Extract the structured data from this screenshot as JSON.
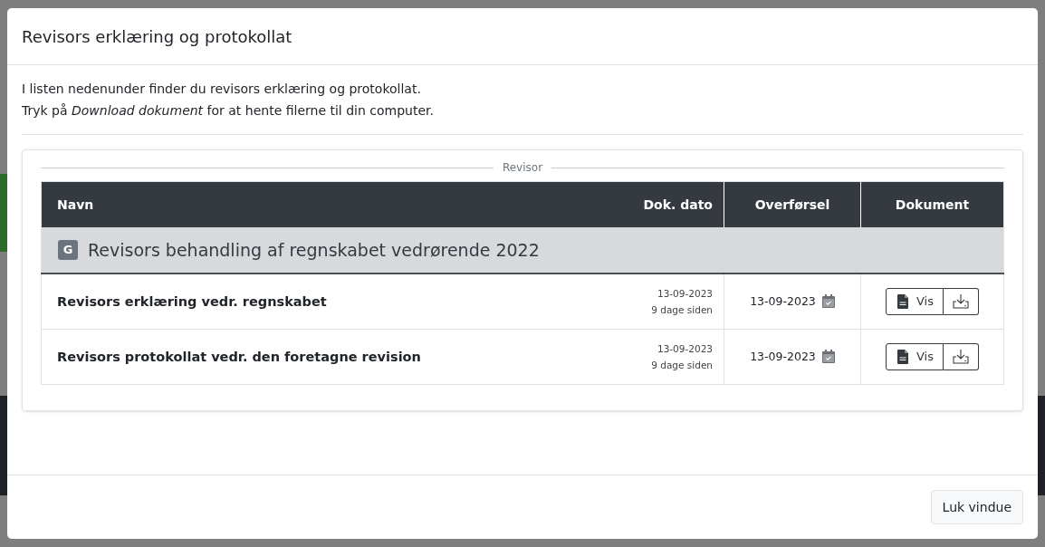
{
  "modal": {
    "title": "Revisors erklæring og protokollat"
  },
  "intro": [
    "I listen nedenunder finder du revisors erklæring og protokollat.",
    "Tryk på *Download dokument* for at hente filerne til din computer."
  ],
  "section": {
    "legend": "Revisor"
  },
  "table": {
    "columns": [
      "Navn",
      "Dok. dato",
      "Overførsel",
      "Dokument"
    ],
    "group": {
      "badge": "G",
      "title": "Revisors behandling af regnskabet vedrørende 2022"
    },
    "rows": [
      {
        "name": "Revisors erklæring vedr. regnskabet",
        "doc_date": "13-09-2023",
        "doc_age": "9 dage siden",
        "transfer_date": "13-09-2023",
        "view_label": "Vis"
      },
      {
        "name": "Revisors protokollat vedr. den foretagne revision",
        "doc_date": "13-09-2023",
        "doc_age": "9 dage siden",
        "transfer_date": "13-09-2023",
        "view_label": "Vis"
      }
    ]
  },
  "footer": {
    "close_button": "Luk vindue"
  }
}
